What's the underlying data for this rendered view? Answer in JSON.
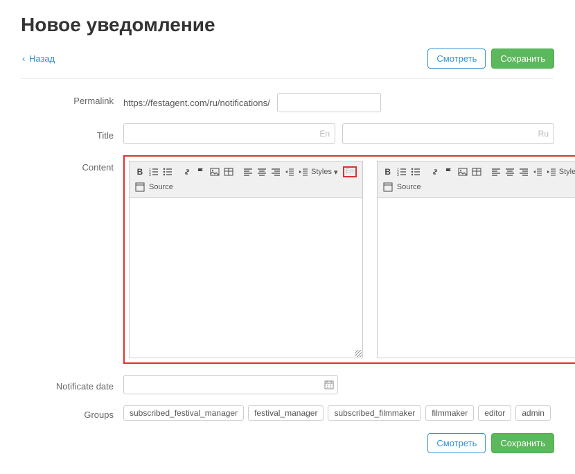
{
  "page": {
    "title": "Новое уведомление"
  },
  "nav": {
    "back": "Назад"
  },
  "buttons": {
    "view": "Смотреть",
    "save": "Сохранить"
  },
  "labels": {
    "permalink": "Permalink",
    "title": "Title",
    "content": "Content",
    "notif_date": "Notificate date",
    "groups": "Groups"
  },
  "permalink": {
    "prefix": "https://festagent.com/ru/notifications/"
  },
  "lang": {
    "en": "En",
    "ru": "Ru"
  },
  "editor": {
    "styles": "Styles",
    "source": "Source"
  },
  "groups": [
    "subscribed_festival_manager",
    "festival_manager",
    "subscribed_filmmaker",
    "filmmaker",
    "editor",
    "admin"
  ]
}
